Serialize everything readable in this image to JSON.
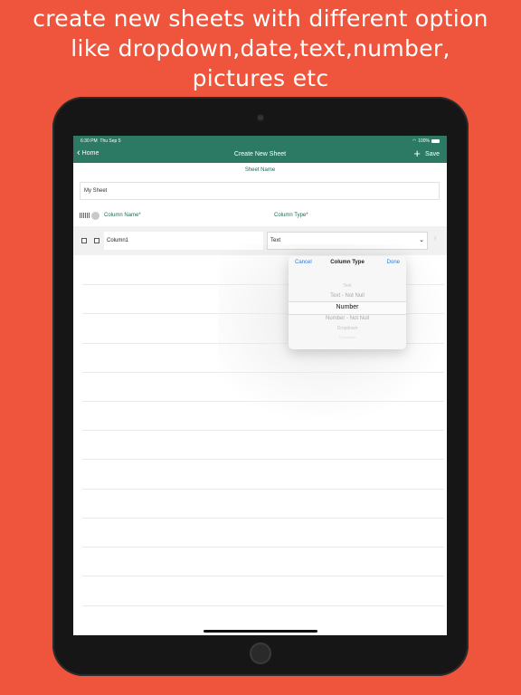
{
  "headline": {
    "line1": "create new sheets with different option",
    "line2": "like dropdown,date,text,number,",
    "line3": "pictures etc"
  },
  "status_bar": {
    "time": "6:30 PM",
    "date": "Thu Sep 5",
    "battery": "100%"
  },
  "nav": {
    "back_label": "Home",
    "title": "Create New Sheet",
    "add_icon": "plus",
    "save_label": "Save"
  },
  "form": {
    "sheet_name_label": "Sheet Name",
    "sheet_name_value": "My Sheet",
    "column_name_header": "Column Name*",
    "column_type_header": "Column Type*"
  },
  "column_row": {
    "name_value": "Column1",
    "type_value": "Text"
  },
  "picker": {
    "cancel_label": "Cancel",
    "title": "Column Type",
    "done_label": "Done",
    "options": [
      "Text",
      "Text - Not Null",
      "Number",
      "Number - Not Null",
      "Dropdown",
      "Dropdown"
    ],
    "selected": "Number"
  },
  "colors": {
    "background": "#ef543c",
    "nav_bar": "#2d7a64",
    "accent_text": "#1f6a55",
    "link_blue": "#2f7bd0"
  },
  "icons": [
    "chevron-left-icon",
    "plus-icon",
    "barcode-icon",
    "gear-icon",
    "checkbox-icon",
    "chevron-down-icon",
    "chevron-right-icon",
    "wifi-icon",
    "battery-icon"
  ]
}
